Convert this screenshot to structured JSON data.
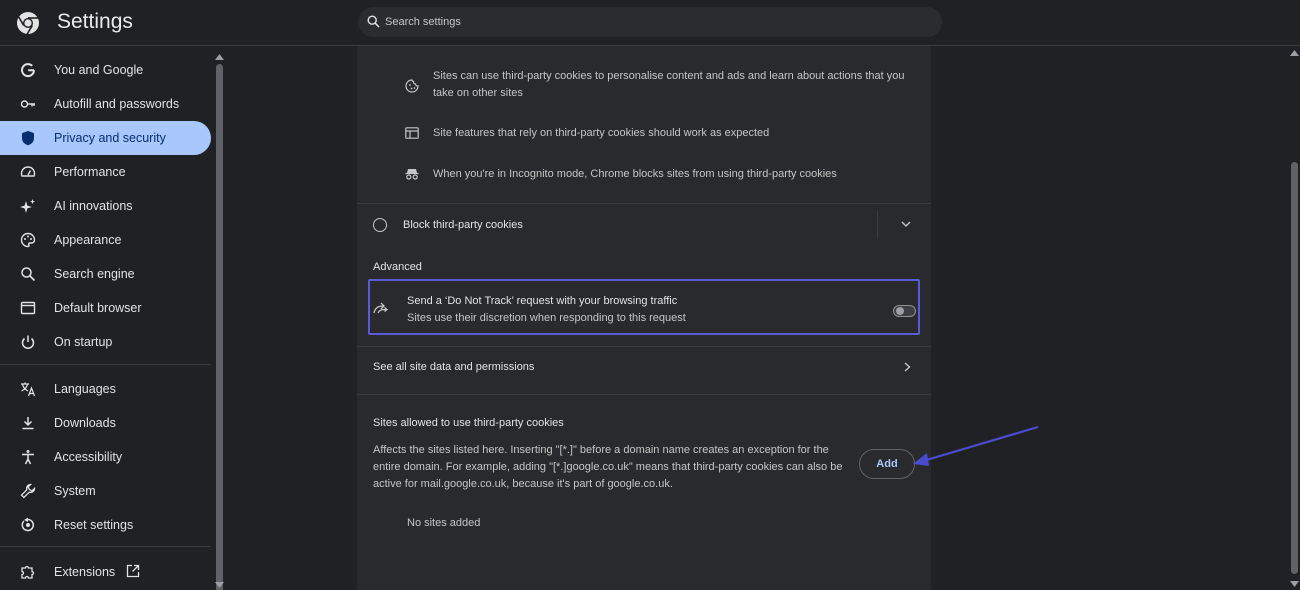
{
  "header": {
    "title": "Settings",
    "search_placeholder": "Search settings"
  },
  "sidebar": {
    "items": [
      {
        "label": "You and Google",
        "icon": "google-icon"
      },
      {
        "label": "Autofill and passwords",
        "icon": "key-icon"
      },
      {
        "label": "Privacy and security",
        "icon": "shield-icon",
        "active": true
      },
      {
        "label": "Performance",
        "icon": "speedometer-icon"
      },
      {
        "label": "AI innovations",
        "icon": "sparkle-icon"
      },
      {
        "label": "Appearance",
        "icon": "palette-icon"
      },
      {
        "label": "Search engine",
        "icon": "search-icon"
      },
      {
        "label": "Default browser",
        "icon": "browser-window-icon"
      },
      {
        "label": "On startup",
        "icon": "power-icon"
      },
      {
        "label": "Languages",
        "icon": "translate-icon"
      },
      {
        "label": "Downloads",
        "icon": "download-icon"
      },
      {
        "label": "Accessibility",
        "icon": "accessibility-icon"
      },
      {
        "label": "System",
        "icon": "wrench-icon"
      },
      {
        "label": "Reset settings",
        "icon": "reset-icon"
      },
      {
        "label": "Extensions",
        "icon": "puzzle-icon"
      }
    ]
  },
  "content": {
    "bullets": [
      {
        "icon": "cookie-icon",
        "text": "Sites can use third-party cookies to personalise content and ads and learn about actions that you take on other sites"
      },
      {
        "icon": "site-features-icon",
        "text": "Site features that rely on third-party cookies should work as expected"
      },
      {
        "icon": "incognito-icon",
        "text": "When you're in Incognito mode, Chrome blocks sites from using third-party cookies"
      }
    ],
    "block_option_label": "Block third-party cookies",
    "advanced_label": "Advanced",
    "dnt": {
      "title": "Send a ‘Do Not Track’ request with your browsing traffic",
      "subtitle": "Sites use their discretion when responding to this request",
      "enabled": false
    },
    "see_all_label": "See all site data and permissions",
    "allowed_title": "Sites allowed to use third-party cookies",
    "allowed_desc": "Affects the sites listed here. Inserting \"[*.]\" before a domain name creates an exception for the entire domain. For example, adding \"[*.]google.co.uk\" means that third-party cookies can also be active for mail.google.co.uk, because it's part of google.co.uk.",
    "add_label": "Add",
    "no_sites_label": "No sites added"
  },
  "colors": {
    "accent": "#a8c7fa",
    "highlight_border": "#5b5bd6",
    "annotation_arrow": "#4b4bd0"
  }
}
